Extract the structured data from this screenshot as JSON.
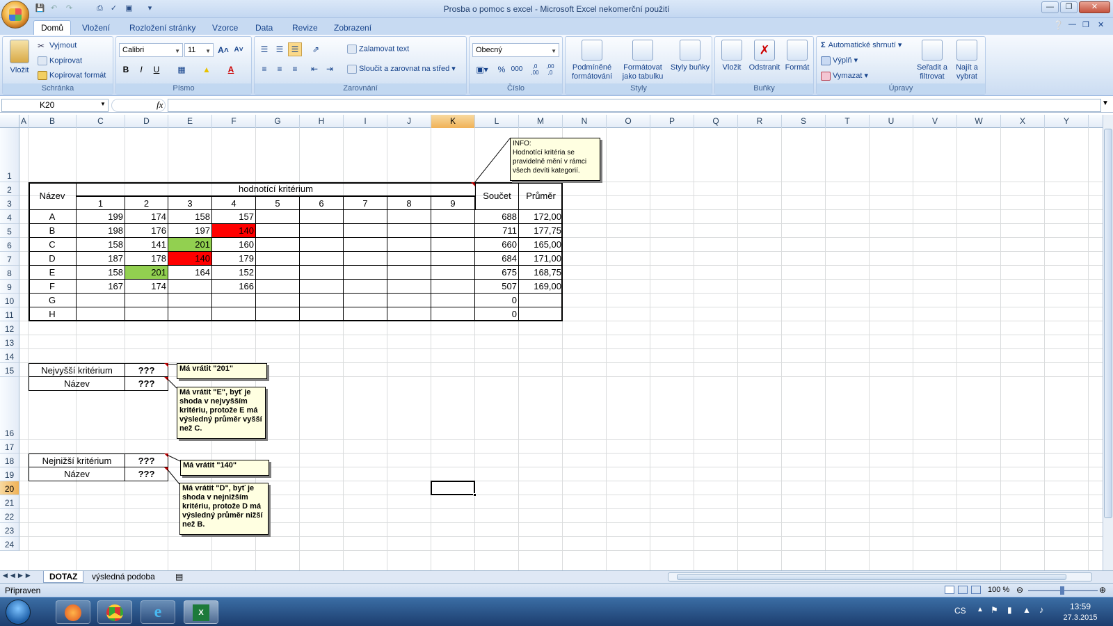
{
  "window": {
    "title": "Prosba o pomoc s excel - Microsoft Excel nekomerční použití"
  },
  "ribbon": {
    "tabs": [
      "Domů",
      "Vložení",
      "Rozložení stránky",
      "Vzorce",
      "Data",
      "Revize",
      "Zobrazení"
    ],
    "clipboard": {
      "label": "Schránka",
      "paste": "Vložit",
      "cut": "Vyjmout",
      "copy": "Kopírovat",
      "format_painter": "Kopírovat formát"
    },
    "font": {
      "label": "Písmo",
      "name": "Calibri",
      "size": "11",
      "bold": "B",
      "italic": "I",
      "underline": "U"
    },
    "alignment": {
      "label": "Zarovnání",
      "wrap": "Zalamovat text",
      "merge": "Sloučit a zarovnat na střed"
    },
    "number": {
      "label": "Číslo",
      "format": "Obecný",
      "percent": "%",
      "thousands": "000",
      "inc_dec": ",0 ,00",
      "dec_dec": ",00 ,0"
    },
    "styles": {
      "label": "Styly",
      "conditional": "Podmíněné formátování",
      "as_table": "Formátovat jako tabulku",
      "cell_styles": "Styly buňky"
    },
    "cells": {
      "label": "Buňky",
      "insert": "Vložit",
      "delete": "Odstranit",
      "format": "Formát"
    },
    "editing": {
      "label": "Úpravy",
      "autosum": "Automatické shrnutí",
      "fill": "Výplň",
      "clear": "Vymazat",
      "sort": "Seřadit a filtrovat",
      "find": "Najít a vybrat"
    }
  },
  "formula_bar": {
    "name_box": "K20",
    "fx": "fx",
    "value": ""
  },
  "columns": [
    "A",
    "B",
    "C",
    "D",
    "E",
    "F",
    "G",
    "H",
    "I",
    "J",
    "K",
    "L",
    "M",
    "N",
    "O",
    "P",
    "Q",
    "R",
    "S",
    "T",
    "U",
    "V",
    "W",
    "X",
    "Y"
  ],
  "selected_column": "K",
  "selected_row": 20,
  "rows": [
    1,
    2,
    3,
    4,
    5,
    6,
    7,
    8,
    9,
    10,
    11,
    12,
    13,
    14,
    15,
    16,
    17,
    18,
    19,
    20,
    21,
    22,
    23,
    24
  ],
  "table": {
    "name_header": "Název",
    "criteria_header": "hodnotící kritérium",
    "criteria": [
      "1",
      "2",
      "3",
      "4",
      "5",
      "6",
      "7",
      "8",
      "9"
    ],
    "sum_header": "Součet",
    "avg_header": "Průměr",
    "data": [
      {
        "name": "A",
        "vals": [
          "199",
          "174",
          "158",
          "157"
        ],
        "sum": "688",
        "avg": "172,00"
      },
      {
        "name": "B",
        "vals": [
          "198",
          "176",
          "197",
          "140"
        ],
        "sum": "711",
        "avg": "177,75"
      },
      {
        "name": "C",
        "vals": [
          "158",
          "141",
          "201",
          "160"
        ],
        "sum": "660",
        "avg": "165,00"
      },
      {
        "name": "D",
        "vals": [
          "187",
          "178",
          "140",
          "179"
        ],
        "sum": "684",
        "avg": "171,00"
      },
      {
        "name": "E",
        "vals": [
          "158",
          "201",
          "164",
          "152"
        ],
        "sum": "675",
        "avg": "168,75"
      },
      {
        "name": "F",
        "vals": [
          "167",
          "174",
          "",
          "166"
        ],
        "sum": "507",
        "avg": "169,00"
      },
      {
        "name": "G",
        "vals": [
          "",
          "",
          "",
          ""
        ],
        "sum": "0",
        "avg": ""
      },
      {
        "name": "H",
        "vals": [
          "",
          "",
          "",
          ""
        ],
        "sum": "0",
        "avg": ""
      }
    ]
  },
  "highlight_colors": {
    "red": "#ff0000",
    "green": "#92d050"
  },
  "lookup": {
    "max_label": "Nejvyšší kritérium",
    "max_value": "???",
    "max_name_label": "Název",
    "max_name_value": "???",
    "min_label": "Nejnižší kritérium",
    "min_value": "???",
    "min_name_label": "Název",
    "min_name_value": "???"
  },
  "comments": {
    "info": "INFO:\nHodnotící kritéria se pravidelně mění v rámci všech devíti kategorií.",
    "max": "Má vrátit \"201\"",
    "max_name": "Má vrátit \"E\", byť je shoda v nejvyšším kritériu, protože E má výsledný průměr vyšší než C.",
    "min": "Má vrátit \"140\"",
    "min_name": "Má vrátit \"D\", byť je shoda v nejnižším kritériu, protože D má výsledný průměr nižší než B."
  },
  "sheets": [
    "DOTAZ",
    "výsledná podoba"
  ],
  "status": {
    "ready": "Připraven",
    "zoom": "100 %"
  },
  "taskbar": {
    "lang": "CS",
    "time": "13:59",
    "date": "27.3.2015"
  }
}
